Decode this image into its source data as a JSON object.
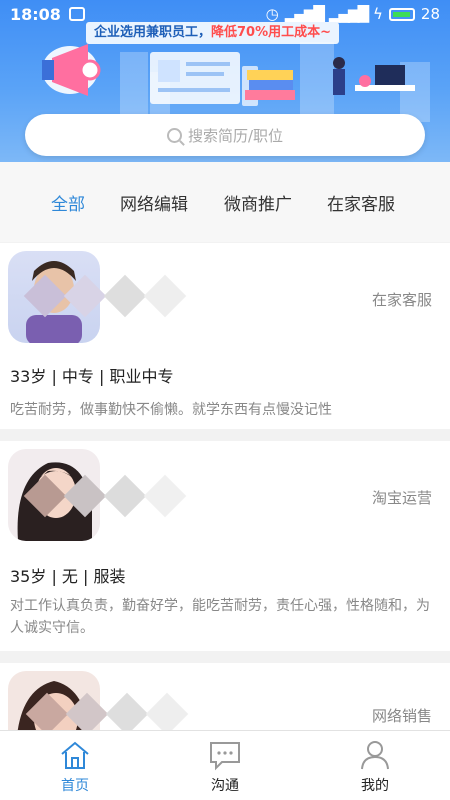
{
  "status_bar": {
    "time": "18:08",
    "battery": "28"
  },
  "banner": {
    "slogan_prefix": "企业选用兼职员工，",
    "slogan_highlight": "降低70%用工成本~"
  },
  "search": {
    "placeholder": "搜索简历/职位"
  },
  "categories": [
    {
      "label": "全部",
      "active": true
    },
    {
      "label": "网络编辑",
      "active": false
    },
    {
      "label": "微商推广",
      "active": false
    },
    {
      "label": "在家客服",
      "active": false
    }
  ],
  "resumes": [
    {
      "job": "在家客服",
      "basic": "33岁 | 中专 | 职业中专",
      "desc": "吃苦耐劳，做事勤快不偷懒。就学东西有点慢没记性"
    },
    {
      "job": "淘宝运营",
      "basic": "35岁 | 无 | 服装",
      "desc": "对工作认真负责，勤奋好学，能吃苦耐劳，责任心强，性格随和，为人诚实守信。"
    },
    {
      "job": "网络销售",
      "basic": "",
      "desc": ""
    }
  ],
  "bottom_nav": [
    {
      "label": "首页",
      "icon": "home-icon",
      "active": true
    },
    {
      "label": "沟通",
      "icon": "chat-icon",
      "active": false
    },
    {
      "label": "我的",
      "icon": "profile-icon",
      "active": false
    }
  ],
  "colors": {
    "accent": "#2f88d8",
    "banner": "#3f8ef5"
  }
}
